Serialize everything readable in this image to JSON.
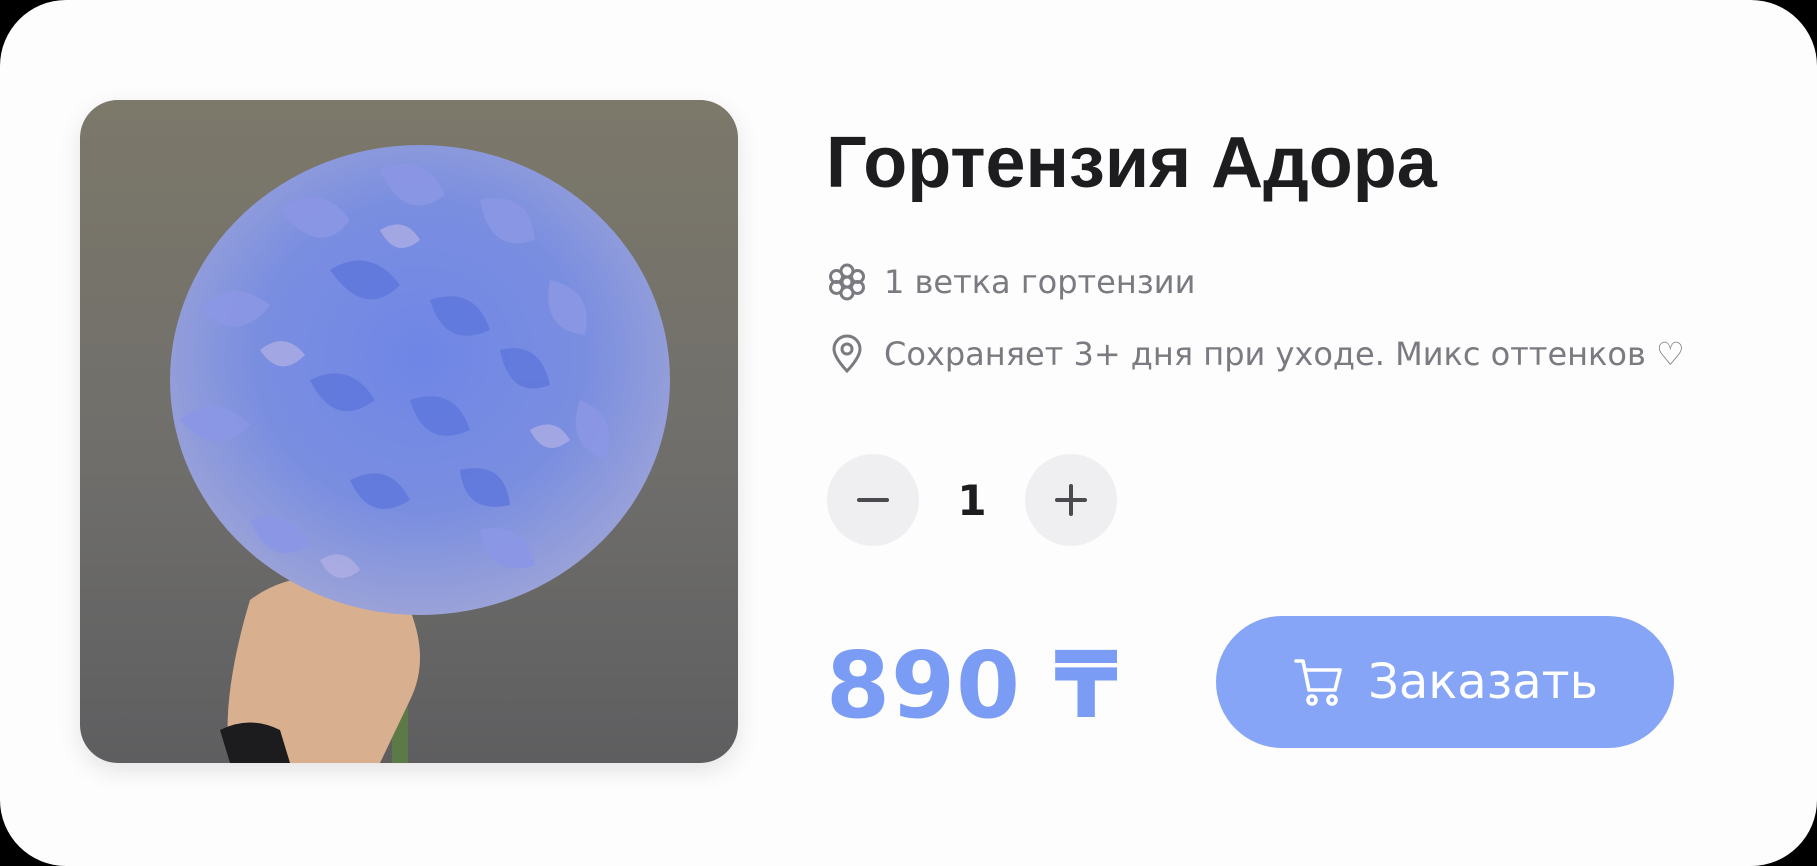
{
  "product": {
    "title": "Гортензия Адора",
    "features": [
      {
        "icon": "flower-icon",
        "text": "1 ветка гортензии"
      },
      {
        "icon": "location-pin-icon",
        "text": "Сохраняет 3+ дня при уходе. Микс оттенков ♡"
      }
    ],
    "quantity": "1",
    "price": "890 ₸",
    "order_label": "Заказать",
    "image": {
      "description_icon": "hydrangea-photo"
    }
  },
  "colors": {
    "accent": "#86a5f6",
    "price": "#7a9cf5",
    "title": "#1d1d1f",
    "muted": "#7a7a80",
    "qty_bg": "#efeff1"
  }
}
